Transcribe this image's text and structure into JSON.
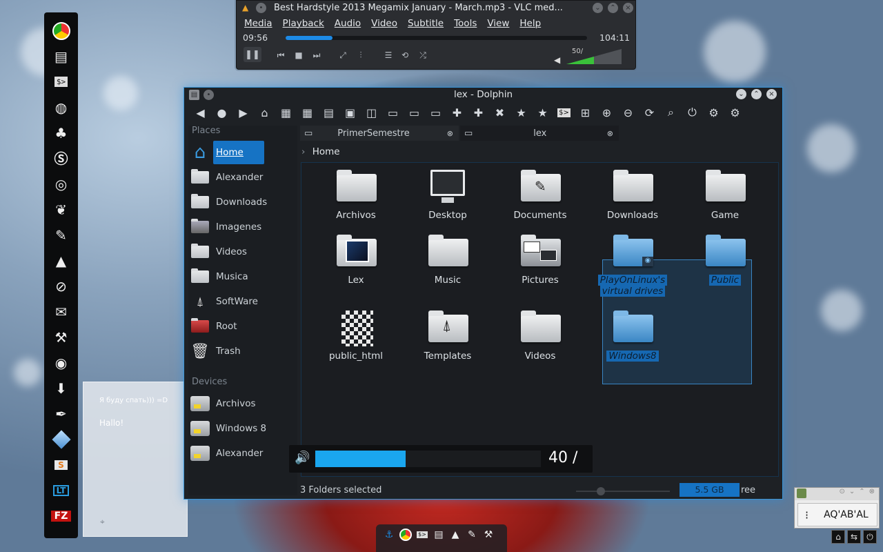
{
  "note_widget": {
    "line1": "Я буду спать))) =D",
    "line2": "Hallo!"
  },
  "vlc": {
    "title": "Best Hardstyle 2013 Megamix January - March.mp3 - VLC med...",
    "menu": [
      "Media",
      "Playback",
      "Audio",
      "Video",
      "Subtitle",
      "Tools",
      "View",
      "Help"
    ],
    "elapsed": "09:56",
    "duration": "104:11",
    "progress": 0.155,
    "volume_label": "50/",
    "volume_fraction": 0.5
  },
  "dolphin": {
    "title": "lex - Dolphin",
    "places_header": "Places",
    "places": [
      "Home",
      "Alexander",
      "Downloads",
      "Imagenes",
      "Videos",
      "Musica",
      "SoftWare",
      "Root",
      "Trash"
    ],
    "devices_header": "Devices",
    "devices": [
      "Archivos",
      "Windows 8",
      "Alexander"
    ],
    "tabs": [
      "PrimerSemestre",
      "lex"
    ],
    "breadcrumb": "Home",
    "items": [
      {
        "label": "Archivos"
      },
      {
        "label": "Desktop"
      },
      {
        "label": "Documents"
      },
      {
        "label": "Downloads"
      },
      {
        "label": "Game"
      },
      {
        "label": "Lex"
      },
      {
        "label": "Music"
      },
      {
        "label": "Pictures"
      },
      {
        "label": "PlayOnLinux's",
        "label2": "virtual drives"
      },
      {
        "label": "Public"
      },
      {
        "label": "public_html"
      },
      {
        "label": "Templates"
      },
      {
        "label": "Videos"
      },
      {
        "label": "Windows8"
      }
    ],
    "status": "3 Folders selected",
    "free_space": "5.5 GB",
    "free_suffix": "ree"
  },
  "osd": {
    "volume_text": "40 /",
    "volume_fraction": 0.4
  },
  "clock_widget": {
    "text": "AQ'AB'AL"
  },
  "colors": {
    "accent": "#1673c4",
    "selection": "#1668b2",
    "vlc_progress": "#1d8ae6",
    "osd_fill": "#1aa6ef"
  }
}
